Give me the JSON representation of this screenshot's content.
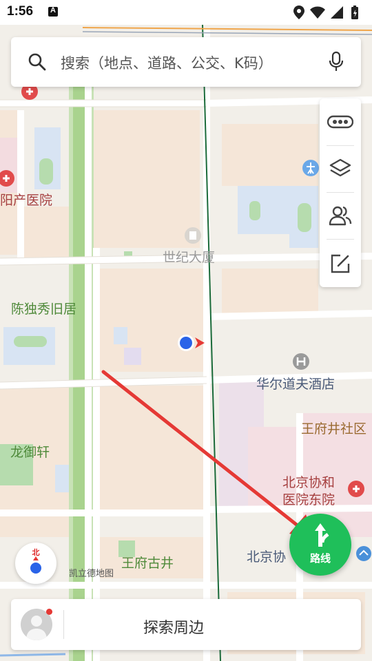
{
  "status_bar": {
    "time": "1:56",
    "notification_icon": "a-icon"
  },
  "search": {
    "placeholder": "搜索（地点、道路、公交、K码）"
  },
  "toolbar": {
    "items": [
      {
        "name": "traffic-icon"
      },
      {
        "name": "layers-icon"
      },
      {
        "name": "team-icon"
      },
      {
        "name": "report-icon"
      }
    ]
  },
  "map_labels": {
    "hospital": "阳产医院",
    "building": "世纪大厦",
    "chen_duxiu": "陈独秀旧居",
    "hotel": "华尔道夫酒店",
    "community": "王府井社区",
    "longyu": "龙御轩",
    "pumc_east_1": "北京协和",
    "pumc_east_2": "医院东院",
    "wangfu_well": "王府古井",
    "pumc": "北京协",
    "watermark": "凯立德地图"
  },
  "compass": {
    "north_label": "北"
  },
  "route_button": {
    "label": "路线"
  },
  "bottom_bar": {
    "explore_label": "探索周边"
  },
  "colors": {
    "route_green": "#1fbf5a",
    "map_bg": "#f2efe9",
    "location_blue": "#2a63e8",
    "annotation_red": "#e53935"
  }
}
